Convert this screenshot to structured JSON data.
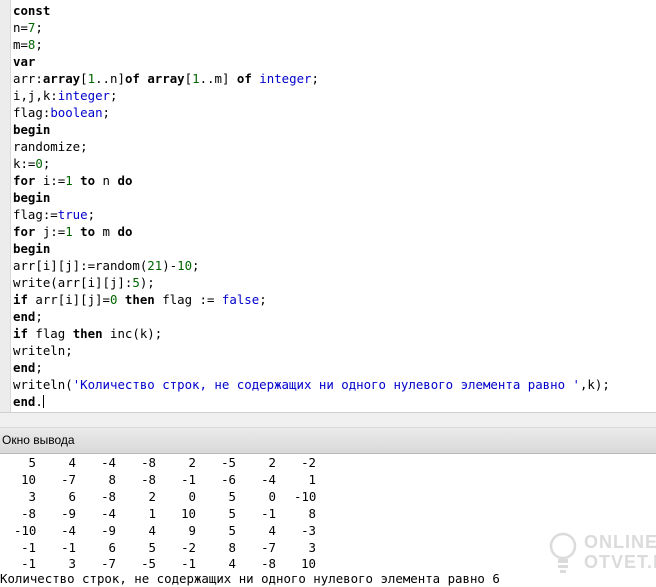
{
  "editor": {
    "lines": [
      [
        {
          "t": "const",
          "c": "kw"
        }
      ],
      [
        {
          "t": "n=",
          "c": "idt"
        },
        {
          "t": "7",
          "c": "num"
        },
        {
          "t": ";",
          "c": "idt"
        }
      ],
      [
        {
          "t": "m=",
          "c": "idt"
        },
        {
          "t": "8",
          "c": "num"
        },
        {
          "t": ";",
          "c": "idt"
        }
      ],
      [
        {
          "t": "var",
          "c": "kw"
        }
      ],
      [
        {
          "t": "arr:",
          "c": "idt"
        },
        {
          "t": "array",
          "c": "kw"
        },
        {
          "t": "[",
          "c": "idt"
        },
        {
          "t": "1",
          "c": "num"
        },
        {
          "t": "..n]",
          "c": "idt"
        },
        {
          "t": "of",
          "c": "kw"
        },
        {
          "t": " ",
          "c": "idt"
        },
        {
          "t": "array",
          "c": "kw"
        },
        {
          "t": "[",
          "c": "idt"
        },
        {
          "t": "1",
          "c": "num"
        },
        {
          "t": "..m] ",
          "c": "idt"
        },
        {
          "t": "of",
          "c": "kw"
        },
        {
          "t": " ",
          "c": "idt"
        },
        {
          "t": "integer",
          "c": "typ"
        },
        {
          "t": ";",
          "c": "idt"
        }
      ],
      [
        {
          "t": "i,j,k:",
          "c": "idt"
        },
        {
          "t": "integer",
          "c": "typ"
        },
        {
          "t": ";",
          "c": "idt"
        }
      ],
      [
        {
          "t": "flag:",
          "c": "idt"
        },
        {
          "t": "boolean",
          "c": "typ"
        },
        {
          "t": ";",
          "c": "idt"
        }
      ],
      [
        {
          "t": "begin",
          "c": "kw"
        }
      ],
      [
        {
          "t": "randomize;",
          "c": "idt"
        }
      ],
      [
        {
          "t": "k:=",
          "c": "idt"
        },
        {
          "t": "0",
          "c": "num"
        },
        {
          "t": ";",
          "c": "idt"
        }
      ],
      [
        {
          "t": "for",
          "c": "kw"
        },
        {
          "t": " i:=",
          "c": "idt"
        },
        {
          "t": "1",
          "c": "num"
        },
        {
          "t": " ",
          "c": "idt"
        },
        {
          "t": "to",
          "c": "kw"
        },
        {
          "t": " n ",
          "c": "idt"
        },
        {
          "t": "do",
          "c": "kw"
        }
      ],
      [
        {
          "t": "begin",
          "c": "kw"
        }
      ],
      [
        {
          "t": "flag:=",
          "c": "idt"
        },
        {
          "t": "true",
          "c": "typ"
        },
        {
          "t": ";",
          "c": "idt"
        }
      ],
      [
        {
          "t": "for",
          "c": "kw"
        },
        {
          "t": " j:=",
          "c": "idt"
        },
        {
          "t": "1",
          "c": "num"
        },
        {
          "t": " ",
          "c": "idt"
        },
        {
          "t": "to",
          "c": "kw"
        },
        {
          "t": " m ",
          "c": "idt"
        },
        {
          "t": "do",
          "c": "kw"
        }
      ],
      [
        {
          "t": "begin",
          "c": "kw"
        }
      ],
      [
        {
          "t": "arr[i][j]:=random(",
          "c": "idt"
        },
        {
          "t": "21",
          "c": "num"
        },
        {
          "t": ")-",
          "c": "idt"
        },
        {
          "t": "10",
          "c": "num"
        },
        {
          "t": ";",
          "c": "idt"
        }
      ],
      [
        {
          "t": "write(arr[i][j]:",
          "c": "idt"
        },
        {
          "t": "5",
          "c": "num"
        },
        {
          "t": ");",
          "c": "idt"
        }
      ],
      [
        {
          "t": "if",
          "c": "kw"
        },
        {
          "t": " arr[i][j]=",
          "c": "idt"
        },
        {
          "t": "0",
          "c": "num"
        },
        {
          "t": " ",
          "c": "idt"
        },
        {
          "t": "then",
          "c": "kw"
        },
        {
          "t": " flag := ",
          "c": "idt"
        },
        {
          "t": "false",
          "c": "typ"
        },
        {
          "t": ";",
          "c": "idt"
        }
      ],
      [
        {
          "t": "end",
          "c": "kw"
        },
        {
          "t": ";",
          "c": "idt"
        }
      ],
      [
        {
          "t": "if",
          "c": "kw"
        },
        {
          "t": " flag ",
          "c": "idt"
        },
        {
          "t": "then",
          "c": "kw"
        },
        {
          "t": " inc(k);",
          "c": "idt"
        }
      ],
      [
        {
          "t": "writeln;",
          "c": "idt"
        }
      ],
      [
        {
          "t": "end",
          "c": "kw"
        },
        {
          "t": ";",
          "c": "idt"
        }
      ],
      [
        {
          "t": "writeln(",
          "c": "idt"
        },
        {
          "t": "'Количество строк, не содержащих ни одного нулевого элемента равно '",
          "c": "str"
        },
        {
          "t": ",k);",
          "c": "idt"
        }
      ],
      [
        {
          "t": "end",
          "c": "kw"
        },
        {
          "t": ".",
          "c": "idt"
        }
      ]
    ]
  },
  "output_panel": {
    "title": "Окно вывода",
    "rows": [
      [
        "5",
        "4",
        "-4",
        "-8",
        "2",
        "-5",
        "2",
        "-2"
      ],
      [
        "10",
        "-7",
        "8",
        "-8",
        "-1",
        "-6",
        "-4",
        "1"
      ],
      [
        "3",
        "6",
        "-8",
        "2",
        "0",
        "5",
        "0",
        "-10"
      ],
      [
        "-8",
        "-9",
        "-4",
        "1",
        "10",
        "5",
        "-1",
        "8"
      ],
      [
        "-10",
        "-4",
        "-9",
        "4",
        "9",
        "5",
        "4",
        "-3"
      ],
      [
        "-1",
        "-1",
        "6",
        "5",
        "-2",
        "8",
        "-7",
        "3"
      ],
      [
        "-1",
        "3",
        "-7",
        "-5",
        "-1",
        "4",
        "-8",
        "10"
      ]
    ],
    "result_line": "Количество строк, не содержащих ни одного нулевого элемента равно 6"
  },
  "watermark": {
    "line1": "ONLINE",
    "line2": "OTVET.RU",
    "icon": "lightbulb-icon"
  },
  "colors": {
    "keyword": "#000000",
    "number": "#006400",
    "type": "#0000cc",
    "string": "#0000cc"
  }
}
